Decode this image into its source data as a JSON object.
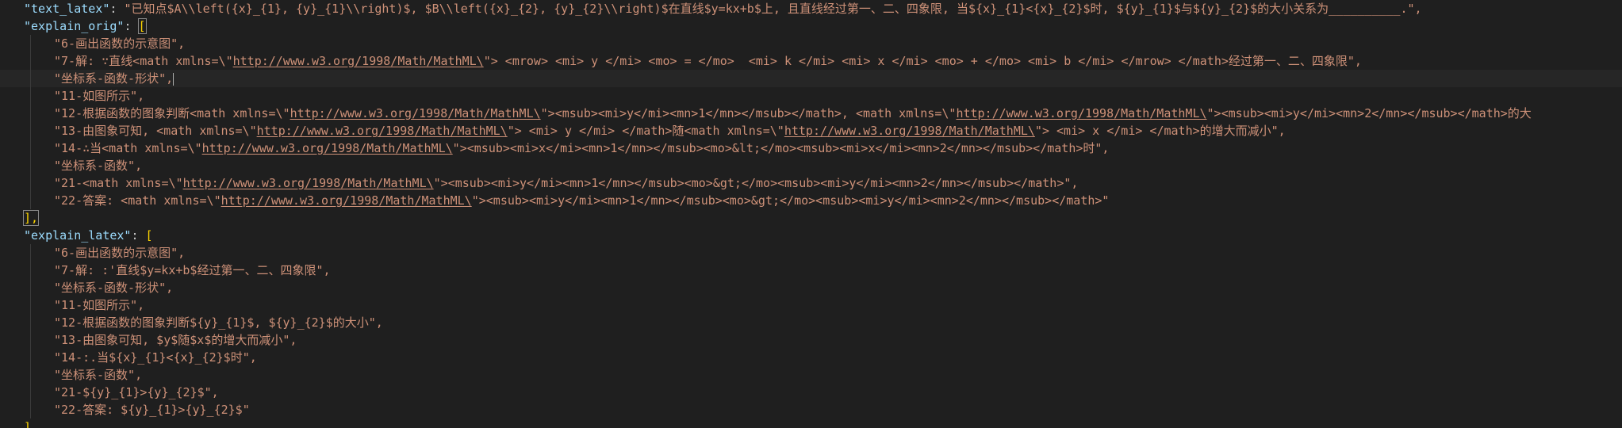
{
  "editor": {
    "lines": [
      {
        "type": "kv",
        "key": "\"text_latex\"",
        "value": "\"已知点$A\\\\left({x}_{1}, {y}_{1}\\\\right)$, $B\\\\left({x}_{2}, {y}_{2}\\\\right)$在直线$y=kx+b$上, 且直线经过第一、二、四象限, 当${x}_{1}<{x}_{2}$时, ${y}_{1}$与${y}_{2}$的大小关系为__________.\","
      },
      {
        "type": "open",
        "key": "\"explain_orig\"",
        "bracket": "["
      },
      {
        "type": "item",
        "pre": "\"6-画出函数的示意图\",",
        "url": "",
        "post": ""
      },
      {
        "type": "item",
        "pre": "\"7-解: ∵直线<math xmlns=\\\"",
        "url": "http://www.w3.org/1998/Math/MathML\\",
        "post": "\"> <mrow> <mi> y </mi> <mo> = </mo>  <mi> k </mi> <mi> x </mi> <mo> + </mo> <mi> b </mi> </mrow> </math>经过第一、二、四象限\","
      },
      {
        "type": "item",
        "pre": "\"坐标系-函数-形状\",",
        "url": "",
        "post": "",
        "cursor": true
      },
      {
        "type": "item",
        "pre": "\"11-如图所示\",",
        "url": "",
        "post": ""
      },
      {
        "type": "item2",
        "pre": "\"12-根据函数的图象判断<math xmlns=\\\"",
        "url": "http://www.w3.org/1998/Math/MathML\\",
        "mid": "\"><msub><mi>y</mi><mn>1</mn></msub></math>, <math xmlns=\\\"",
        "url2": "http://www.w3.org/1998/Math/MathML\\",
        "post": "\"><msub><mi>y</mi><mn>2</mn></msub></math>的大"
      },
      {
        "type": "item2",
        "pre": "\"13-由图象可知, <math xmlns=\\\"",
        "url": "http://www.w3.org/1998/Math/MathML\\",
        "mid": "\"> <mi> y </mi> </math>随<math xmlns=\\\"",
        "url2": "http://www.w3.org/1998/Math/MathML\\",
        "post": "\"> <mi> x </mi> </math>的增大而减小\","
      },
      {
        "type": "item",
        "pre": "\"14-∴当<math xmlns=\\\"",
        "url": "http://www.w3.org/1998/Math/MathML\\",
        "post": "\"><msub><mi>x</mi><mn>1</mn></msub><mo>&lt;</mo><msub><mi>x</mi><mn>2</mn></msub></math>时\","
      },
      {
        "type": "item",
        "pre": "\"坐标系-函数\",",
        "url": "",
        "post": ""
      },
      {
        "type": "item",
        "pre": "\"21-<math xmlns=\\\"",
        "url": "http://www.w3.org/1998/Math/MathML\\",
        "post": "\"><msub><mi>y</mi><mn>1</mn></msub><mo>&gt;</mo><msub><mi>y</mi><mn>2</mn></msub></math>\","
      },
      {
        "type": "item",
        "pre": "\"22-答案: <math xmlns=\\\"",
        "url": "http://www.w3.org/1998/Math/MathML\\",
        "post": "\"><msub><mi>y</mi><mn>1</mn></msub><mo>&gt;</mo><msub><mi>y</mi><mn>2</mn></msub></math>\""
      },
      {
        "type": "close",
        "text": "],"
      },
      {
        "type": "open",
        "key": "\"explain_latex\"",
        "bracket": "["
      },
      {
        "type": "item",
        "pre": "\"6-画出函数的示意图\",",
        "url": "",
        "post": ""
      },
      {
        "type": "item",
        "pre": "\"7-解: :'直线$y=kx+b$经过第一、二、四象限\",",
        "url": "",
        "post": ""
      },
      {
        "type": "item",
        "pre": "\"坐标系-函数-形状\",",
        "url": "",
        "post": ""
      },
      {
        "type": "item",
        "pre": "\"11-如图所示\",",
        "url": "",
        "post": ""
      },
      {
        "type": "item",
        "pre": "\"12-根据函数的图象判断${y}_{1}$, ${y}_{2}$的大小\",",
        "url": "",
        "post": ""
      },
      {
        "type": "item",
        "pre": "\"13-由图象可知, $y$随$x$的增大而减小\",",
        "url": "",
        "post": ""
      },
      {
        "type": "item",
        "pre": "\"14-:.当${x}_{1}<{x}_{2}$时\",",
        "url": "",
        "post": ""
      },
      {
        "type": "item",
        "pre": "\"坐标系-函数\",",
        "url": "",
        "post": ""
      },
      {
        "type": "item",
        "pre": "\"21-${y}_{1}>{y}_{2}$\",",
        "url": "",
        "post": ""
      },
      {
        "type": "item",
        "pre": "\"22-答案: ${y}_{1}>{y}_{2}$\"",
        "url": "",
        "post": ""
      },
      {
        "type": "close",
        "text": "]"
      }
    ]
  }
}
